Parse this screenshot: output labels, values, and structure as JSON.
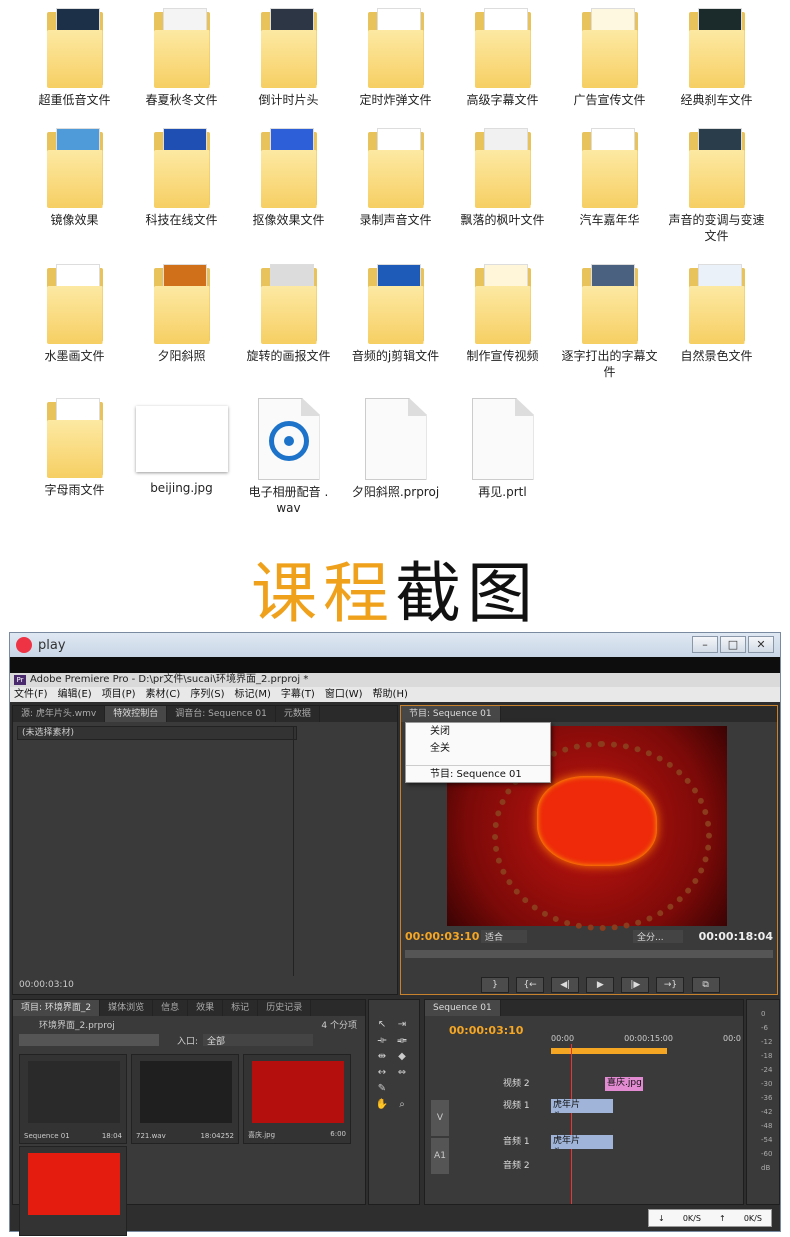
{
  "files": [
    {
      "label": "超重低音文件",
      "kind": "folder",
      "preview": "#1c3147"
    },
    {
      "label": "春夏秋冬文件",
      "kind": "folder",
      "preview": "#f4f4f4"
    },
    {
      "label": "倒计时片头",
      "kind": "folder",
      "preview": "#2c3644"
    },
    {
      "label": "定时炸弹文件",
      "kind": "folder",
      "preview": "#ffffff"
    },
    {
      "label": "高级字幕文件",
      "kind": "folder",
      "preview": "#ffffff"
    },
    {
      "label": "广告宣传文件",
      "kind": "folder",
      "preview": "#fff8e0"
    },
    {
      "label": "经典刹车文件",
      "kind": "folder",
      "preview": "#1b2a2a"
    },
    {
      "label": "镜像效果",
      "kind": "folder",
      "preview": "#4f9ad8"
    },
    {
      "label": "科技在线文件",
      "kind": "folder",
      "preview": "#1f4fb2"
    },
    {
      "label": "抠像效果文件",
      "kind": "folder",
      "preview": "#2d5fd9"
    },
    {
      "label": "录制声音文件",
      "kind": "folder",
      "preview": "#ffffff"
    },
    {
      "label": "飘落的枫叶文件",
      "kind": "folder",
      "preview": "#f1f1f1"
    },
    {
      "label": "汽车嘉年华",
      "kind": "folder",
      "preview": "#ffffff"
    },
    {
      "label": "声音的变调与变速文件",
      "kind": "folder",
      "preview": "#2a3d4a"
    },
    {
      "label": "水墨画文件",
      "kind": "folder",
      "preview": "#ffffff"
    },
    {
      "label": "夕阳斜照",
      "kind": "folder",
      "preview": "#d1701a"
    },
    {
      "label": "旋转的画报文件",
      "kind": "folder",
      "preview": "#dcdcdc"
    },
    {
      "label": "音频的j剪辑文件",
      "kind": "folder",
      "preview": "#1e5ab8"
    },
    {
      "label": "制作宣传视频",
      "kind": "folder",
      "preview": "#fff5d8"
    },
    {
      "label": "逐字打出的字幕文件",
      "kind": "folder",
      "preview": "#4a6180"
    },
    {
      "label": "自然景色文件",
      "kind": "folder",
      "preview": "#eaf1f8"
    },
    {
      "label": "字母雨文件",
      "kind": "folder",
      "preview": "#ffffff"
    },
    {
      "label": "beijing.jpg",
      "kind": "image",
      "preview": "#ffffff"
    },
    {
      "label": "电子相册配音 . wav",
      "kind": "audio",
      "preview": "#1d73c9"
    },
    {
      "label": "夕阳斜照.prproj",
      "kind": "doc",
      "preview": "#ffffff"
    },
    {
      "label": "再见.prtl",
      "kind": "doc",
      "preview": "#ffffff"
    }
  ],
  "section_title": {
    "part1": "课程",
    "part2": "截图"
  },
  "window": {
    "title": "play",
    "app_title": "Adobe Premiere Pro - D:\\pr文件\\sucai\\环境界面_2.prproj *",
    "menu": [
      "文件(F)",
      "编辑(E)",
      "项目(P)",
      "素材(C)",
      "序列(S)",
      "标记(M)",
      "字幕(T)",
      "窗口(W)",
      "帮助(H)"
    ]
  },
  "source_panel": {
    "tabs": [
      "源: 虎年片头.wmv",
      "特效控制台",
      "调音台: Sequence 01",
      "元数据"
    ],
    "no_clip": "(未选择素材)",
    "timecode": "00:00:03:10"
  },
  "program_panel": {
    "tab": "节目: Sequence 01",
    "menu": [
      "关闭",
      "全关",
      "节目: Sequence 01"
    ],
    "timecode": "00:00:03:10",
    "fit": "适合",
    "quality": "全分...",
    "duration": "00:00:18:04"
  },
  "project_panel": {
    "tabs": [
      "项目: 环境界面_2",
      "媒体浏览",
      "信息",
      "效果",
      "标记",
      "历史记录"
    ],
    "name": "环境界面_2.prproj",
    "count": "4 个分项",
    "inlet_label": "入口:",
    "inlet_value": "全部",
    "items": [
      {
        "name": "Sequence 01",
        "dur": "18:04",
        "color": "#2a2a2a"
      },
      {
        "name": "721.wav",
        "dur": "18:04252",
        "color": "#1f1f1f"
      },
      {
        "name": "喜庆.jpg",
        "dur": "6:00",
        "color": "#b50f0d"
      },
      {
        "name": "",
        "dur": "",
        "color": "#e41b0f"
      }
    ]
  },
  "timeline": {
    "tab": "Sequence 01",
    "timecode": "00:00:03:10",
    "ruler": [
      "00:00",
      "00:00:15:00",
      "00:0"
    ],
    "tracks": [
      {
        "name": "视频 2",
        "clip": "喜庆.jpg"
      },
      {
        "name": "视频 1",
        "clip": "虎年片头.wmv"
      },
      {
        "name": "音频 1",
        "clip": "虎年片头.wmv"
      },
      {
        "name": "音频 2",
        "clip": ""
      }
    ],
    "v_label": "V",
    "a_label": "A1"
  },
  "meters": [
    "0",
    "-6",
    "-12",
    "-18",
    "-24",
    "-30",
    "-36",
    "-42",
    "-48",
    "-54",
    "-60",
    "dB"
  ],
  "tray": {
    "down": "0K/S",
    "up": "0K/S"
  },
  "colors": {
    "accent": "#f0a11c",
    "timecode": "#f5a623"
  }
}
